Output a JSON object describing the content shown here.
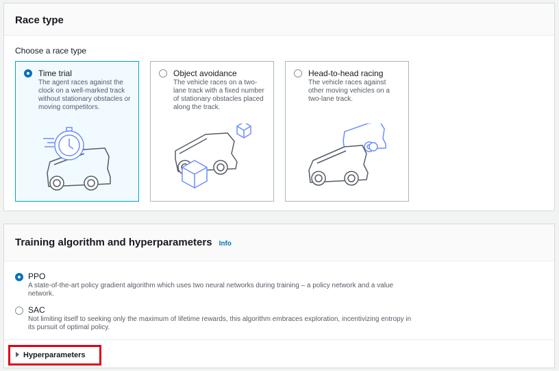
{
  "race_section": {
    "title": "Race type",
    "choose_label": "Choose a race type",
    "options": [
      {
        "title": "Time trial",
        "description": "The agent races against the clock on a well-marked track without stationary obstacles or moving competitors.",
        "selected": true
      },
      {
        "title": "Object avoidance",
        "description": "The vehicle races on a two-lane track with a fixed number of stationary obstacles placed along the track.",
        "selected": false
      },
      {
        "title": "Head-to-head racing",
        "description": "The vehicle races against other moving vehicles on a two-lane track.",
        "selected": false
      }
    ]
  },
  "algo_section": {
    "title": "Training algorithm and hyperparameters",
    "info_link": "Info",
    "options": [
      {
        "title": "PPO",
        "description": "A state-of-the-art policy gradient algorithm which uses two neural networks during training – a policy network and a value network.",
        "selected": true
      },
      {
        "title": "SAC",
        "description": "Not limiting itself to seeking only the maximum of lifetime rewards, this algorithm embraces exploration, incentivizing entropy in its pursuit of optimal policy.",
        "selected": false
      }
    ],
    "expander_label": "Hyperparameters"
  },
  "colors": {
    "accent": "#0073bb",
    "highlight": "#e00016",
    "illustration_blue": "#6b8cff",
    "illustration_gray": "#545b64"
  }
}
